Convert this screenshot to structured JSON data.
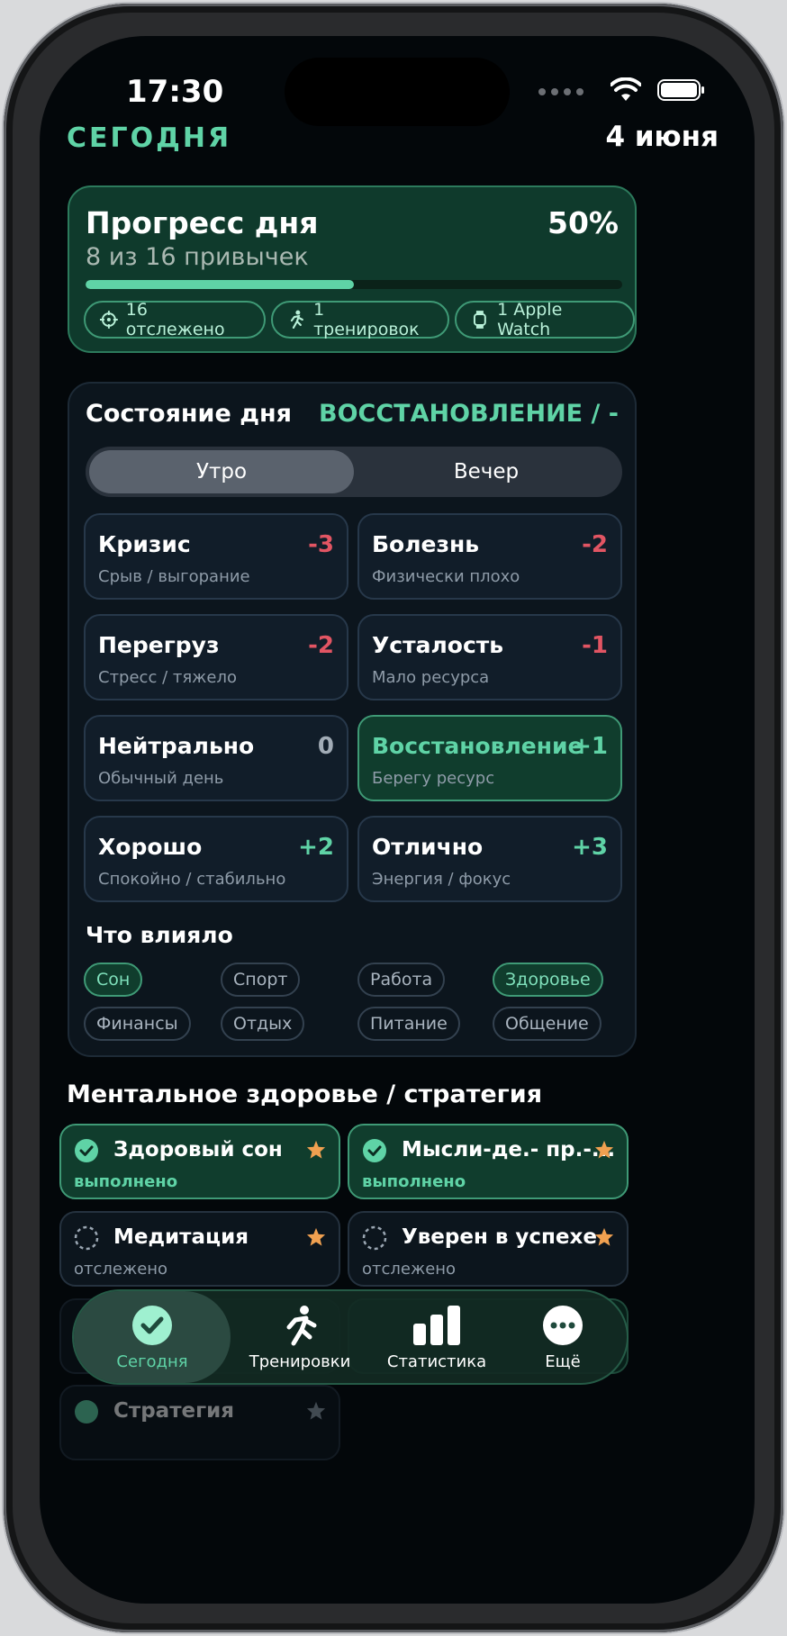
{
  "status": {
    "time": "17:30"
  },
  "header": {
    "today_label": "СЕГОДНЯ",
    "date": "4 июня"
  },
  "progress": {
    "title": "Прогресс дня",
    "subtitle": "8 из 16 привычек",
    "percent_label": "50%",
    "fill_fraction": 0.5,
    "chips": [
      {
        "icon": "target-icon",
        "label": "16 отслежено"
      },
      {
        "icon": "running-icon",
        "label": "1 тренировок"
      },
      {
        "icon": "watch-icon",
        "label": "1 Apple Watch"
      }
    ]
  },
  "day_state": {
    "title": "Состояние дня",
    "current_label": "ВОССТАНОВЛЕНИЕ / -",
    "segments": [
      "Утро",
      "Вечер"
    ],
    "active_segment": "Утро",
    "options": [
      {
        "name": "Кризис",
        "desc": "Срыв / выгорание",
        "score": "-3",
        "selected": false
      },
      {
        "name": "Болезнь",
        "desc": "Физически плохо",
        "score": "-2",
        "selected": false
      },
      {
        "name": "Перегруз",
        "desc": "Стресс / тяжело",
        "score": "-2",
        "selected": false
      },
      {
        "name": "Усталость",
        "desc": "Мало ресурса",
        "score": "-1",
        "selected": false
      },
      {
        "name": "Нейтрально",
        "desc": "Обычный день",
        "score": "0",
        "selected": false
      },
      {
        "name": "Восстановление",
        "desc": "Берегу ресурс",
        "score": "+1",
        "selected": true
      },
      {
        "name": "Хорошо",
        "desc": "Спокойно / стабильно",
        "score": "+2",
        "selected": false
      },
      {
        "name": "Отлично",
        "desc": "Энергия / фокус",
        "score": "+3",
        "selected": false
      }
    ],
    "influence_title": "Что влияло",
    "influences": [
      {
        "label": "Сон",
        "on": true
      },
      {
        "label": "Спорт",
        "on": false
      },
      {
        "label": "Работа",
        "on": false
      },
      {
        "label": "Здоровье",
        "on": true
      },
      {
        "label": "Финансы",
        "on": false
      },
      {
        "label": "Отдых",
        "on": false
      },
      {
        "label": "Питание",
        "on": false
      },
      {
        "label": "Общение",
        "on": false
      }
    ]
  },
  "mental": {
    "title": "Ментальное здоровье / стратегия",
    "habits": [
      {
        "name": "Здоровый сон",
        "status": "выполнено",
        "done": true
      },
      {
        "name": "Мысли-де.- пр.-...",
        "status": "выполнено",
        "done": true
      },
      {
        "name": "Медитация",
        "status": "отслежено",
        "done": false
      },
      {
        "name": "Уверен в успехе",
        "status": "отслежено",
        "done": false
      }
    ],
    "partial_habit": "Стратегия"
  },
  "tabbar": {
    "tabs": [
      {
        "label": "Сегодня",
        "icon": "checkmark-circle-icon",
        "active": true
      },
      {
        "label": "Тренировки",
        "icon": "running-icon",
        "active": false
      },
      {
        "label": "Статистика",
        "icon": "bar-chart-icon",
        "active": false
      },
      {
        "label": "Ещё",
        "icon": "more-icon",
        "active": false
      }
    ]
  },
  "colors": {
    "accent": "#5fd3a6",
    "negative": "#e25563",
    "background": "#03070a",
    "star": "#f0a050"
  }
}
